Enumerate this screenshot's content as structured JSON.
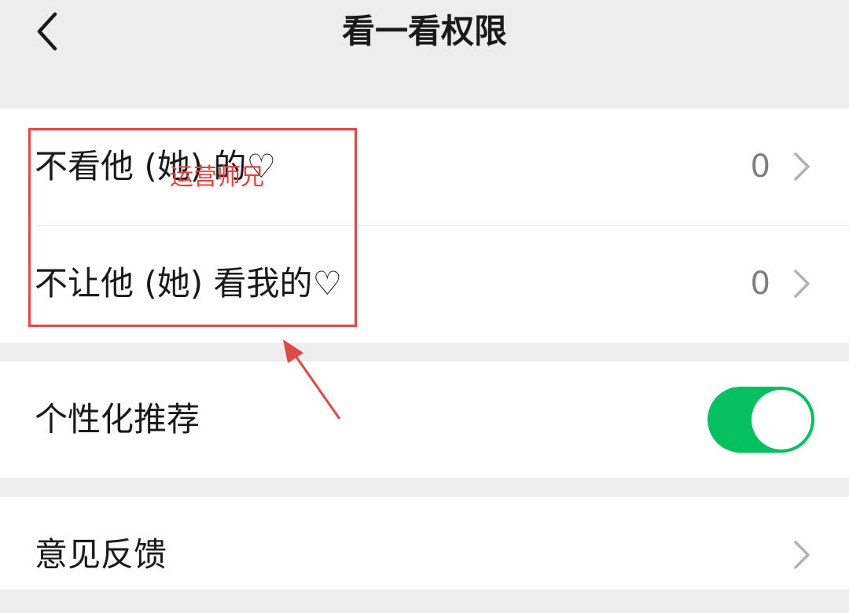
{
  "header": {
    "title": "看一看权限",
    "back_icon": "chevron-left-icon"
  },
  "rows": [
    {
      "label": "不看他 (她) 的♡",
      "value": "0"
    },
    {
      "label": "不让他 (她) 看我的♡",
      "value": "0"
    },
    {
      "label": "个性化推荐",
      "toggle_on": true
    },
    {
      "label": "意见反馈"
    }
  ],
  "watermark": {
    "text": "运营师兄"
  },
  "colors": {
    "background": "#ededed",
    "card": "#ffffff",
    "toggle_on": "#07c160",
    "annotation": "#e04848",
    "secondary_text": "#7f7f7f"
  }
}
